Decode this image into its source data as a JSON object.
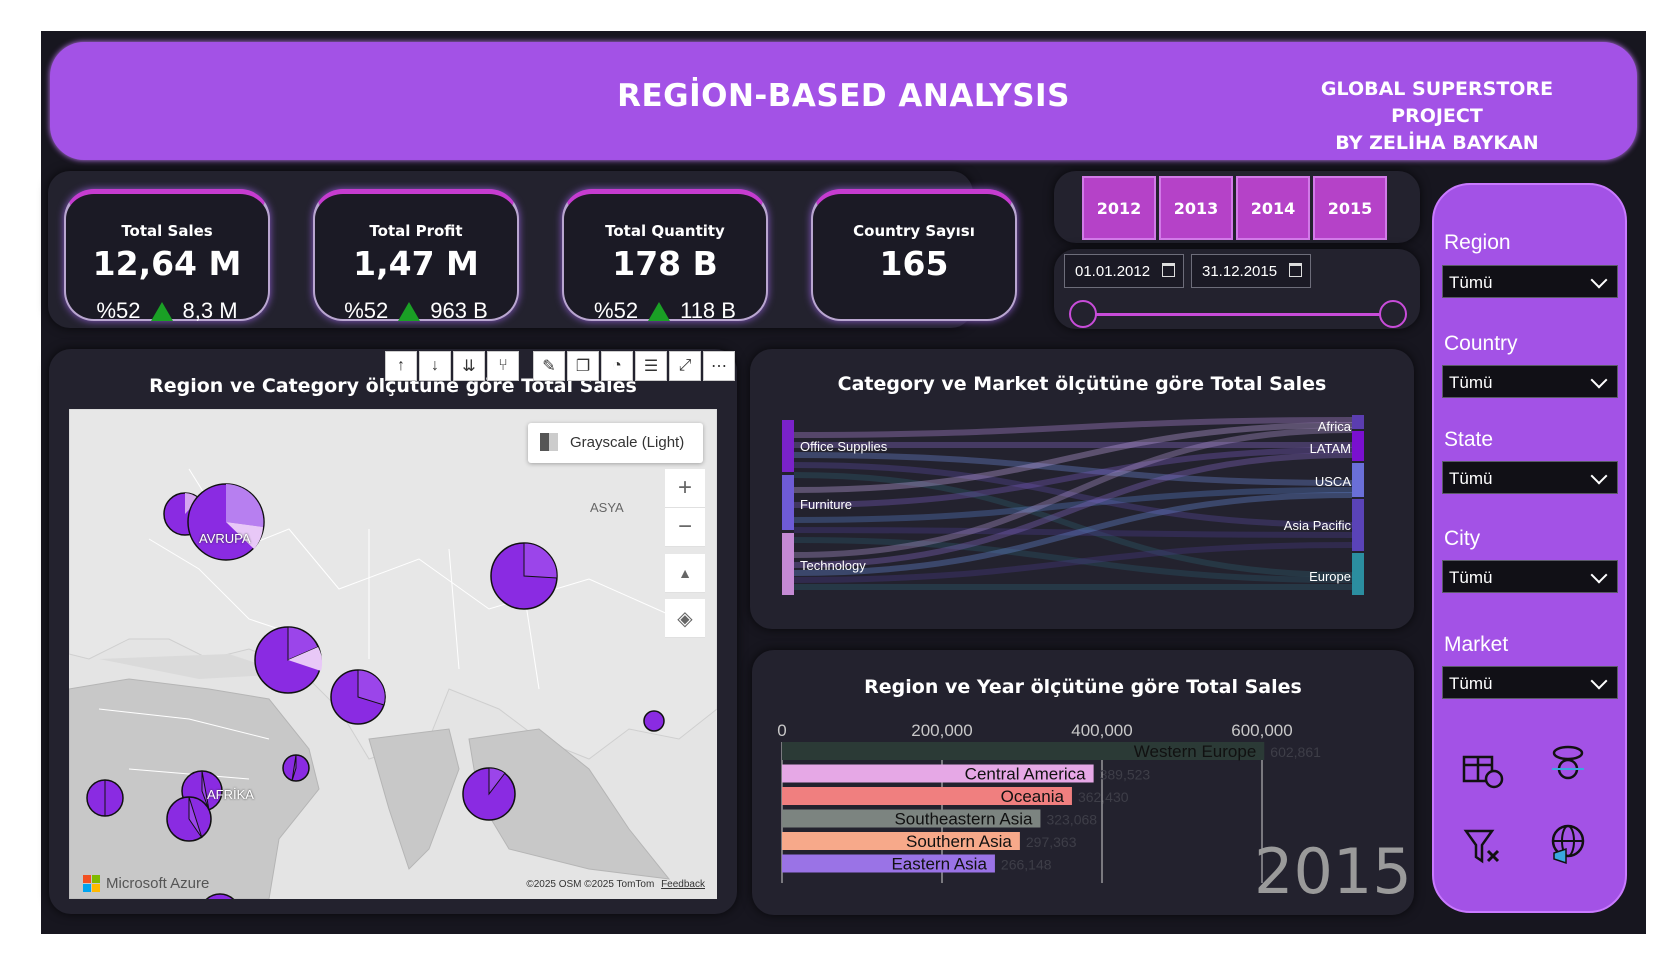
{
  "header": {
    "title": "REGİON-BASED ANALYSIS",
    "subtitle_line1": "GLOBAL SUPERSTORE PROJECT",
    "subtitle_line2": "BY ZELİHA BAYKAN"
  },
  "kpis": [
    {
      "label": "Total Sales",
      "value": "12,64 M",
      "pct": "%52",
      "delta": "8,3 M"
    },
    {
      "label": "Total Profit",
      "value": "1,47 M",
      "pct": "%52",
      "delta": "963 B"
    },
    {
      "label": "Total Quantity",
      "value": "178 B",
      "pct": "%52",
      "delta": "118 B"
    },
    {
      "label": "Country Sayısı",
      "value": "165"
    }
  ],
  "years": [
    "2012",
    "2013",
    "2014",
    "2015"
  ],
  "date_range": {
    "start": "01.01.2012",
    "end": "31.12.2015",
    "slider_start": 0,
    "slider_end": 1
  },
  "filters": [
    {
      "label": "Region",
      "value": "Tümü"
    },
    {
      "label": "Country",
      "value": "Tümü"
    },
    {
      "label": "State",
      "value": "Tümü"
    },
    {
      "label": "City",
      "value": "Tümü"
    },
    {
      "label": "Market",
      "value": "Tümü"
    }
  ],
  "filter_icons": [
    "gift-filter-icon",
    "person-filter-icon",
    "clear-filter-icon",
    "globe-megaphone-icon"
  ],
  "map_panel": {
    "title": "Region ve Category ölçütüne göre Total Sales",
    "style_label": "Grayscale (Light)",
    "labels": {
      "asia": "ASYA",
      "europe": "AVRUPA",
      "africa": "AFRİKA"
    },
    "brand": "Microsoft Azure",
    "copyright": "©2025 OSM  ©2025 TomTom",
    "feedback": "Feedback",
    "toolbar_icons": [
      "drill-up-icon",
      "drill-down-icon",
      "expand-all-icon",
      "fork-icon",
      "pin-icon",
      "copy-icon",
      "bell-icon",
      "filter-icon",
      "focus-icon",
      "more-icon"
    ]
  },
  "sankey_panel": {
    "title": "Category ve Market ölçütüne göre Total Sales",
    "left": [
      "Office Supplies",
      "Furniture",
      "Technology"
    ],
    "right": [
      "Africa",
      "LATAM",
      "USCA",
      "Asia Pacific",
      "Europe"
    ]
  },
  "bar_panel": {
    "title": "Region ve Year ölçütüne göre Total Sales",
    "year_watermark": "2015"
  },
  "colors": {
    "accent": "#a352e6",
    "pie": "#8a2be2",
    "pie_light": "#d6a6f0",
    "background": "#17161f"
  },
  "chart_data": [
    {
      "type": "bar",
      "title": "Region ve Year ölçütüne göre Total Sales",
      "orientation": "horizontal",
      "categories": [
        "Western Europe",
        "Central America",
        "Oceania",
        "Southeastern Asia",
        "Southern Asia",
        "Eastern Asia"
      ],
      "values": [
        602861,
        389523,
        362430,
        323068,
        297363,
        266148
      ],
      "value_labels": [
        "602,861",
        "389,523",
        "362,430",
        "323,068",
        "297,363",
        "266,148"
      ],
      "bar_colors": [
        "#2b3a36",
        "#e6a8e6",
        "#f07f7f",
        "#7c8480",
        "#f7a98a",
        "#9a73e6"
      ],
      "xticks": [
        "0",
        "200,000",
        "400,000",
        "600,000"
      ],
      "xlim": [
        0,
        650000
      ],
      "grid": true
    }
  ]
}
